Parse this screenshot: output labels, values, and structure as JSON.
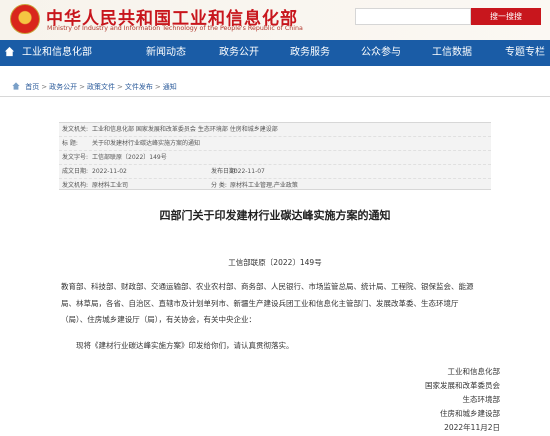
{
  "header": {
    "site_title": "中华人民共和国工业和信息化部",
    "site_subtitle": "Ministry of Industry and Information Technology of the People's Republic of China",
    "search_button": "搜一搜搜"
  },
  "nav": {
    "items": [
      {
        "label": "工业和信息化部"
      },
      {
        "label": "新闻动态"
      },
      {
        "label": "政务公开"
      },
      {
        "label": "政务服务"
      },
      {
        "label": "公众参与"
      },
      {
        "label": "工信数据"
      },
      {
        "label": "专题专栏"
      }
    ]
  },
  "breadcrumb": {
    "items": [
      "首页",
      "政务公开",
      "政策文件",
      "文件发布",
      "通知"
    ],
    "separator": ">"
  },
  "info": {
    "issuer_label": "发文机关:",
    "issuer_value": "工业和信息化部 国家发展和改革委员会 生态环境部 住房和城乡建设部",
    "title_label": "标      题:",
    "title_value": "关于印发建材行业碳达峰实施方案的通知",
    "docno_label": "发文字号:",
    "docno_value": "工信部联原〔2022〕149号",
    "date_label": "成文日期:",
    "date_value": "2022-11-02",
    "pubdate_label": "发布日期:",
    "pubdate_value": "2022-11-07",
    "org_label": "发文机构:",
    "org_value": "原材料工业司",
    "category_label": "分    类:",
    "category_value": "原材料工业管理,产业政策"
  },
  "article": {
    "title": "四部门关于印发建材行业碳达峰实施方案的通知",
    "doc_number": "工信部联原〔2022〕149号",
    "recipients_1": "教育部、科技部、财政部、交通运输部、农业农村部、商务部、人民银行、市场监管总局、统计局、工程院、银保监会、能源",
    "recipients_2": "局、林草局，各省、自治区、直辖市及计划单列市、新疆生产建设兵团工业和信息化主管部门、发展改革委、生态环境厅",
    "recipients_3": "（局）、住房城乡建设厅（局），有关协会，有关中央企业：",
    "body": "现将《建材行业碳达峰实施方案》印发给你们，请认真贯彻落实。",
    "signatures": [
      "工业和信息化部",
      "国家发展和改革委员会",
      "生态环境部",
      "住房和城乡建设部",
      "2022年11月2日"
    ]
  },
  "colors": {
    "brand_red": "#c8161d",
    "nav_blue": "#1a5ca6"
  }
}
